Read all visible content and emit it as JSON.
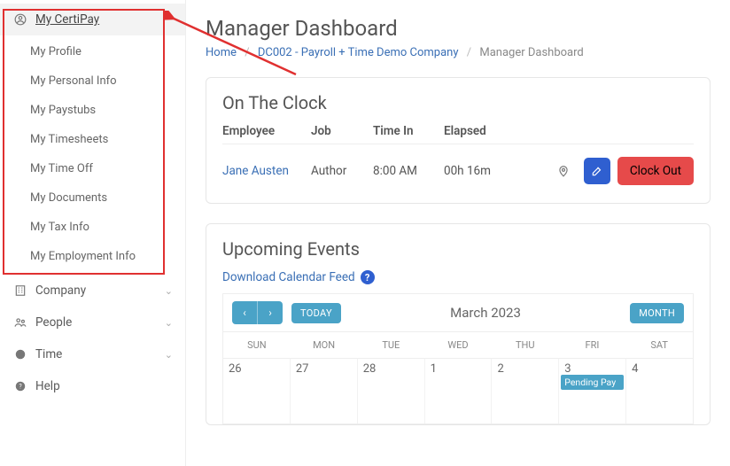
{
  "sidebar": {
    "header": {
      "label": "My CertiPay"
    },
    "items": [
      {
        "label": "My Profile"
      },
      {
        "label": "My Personal Info"
      },
      {
        "label": "My Paystubs"
      },
      {
        "label": "My Timesheets"
      },
      {
        "label": "My Time Off"
      },
      {
        "label": "My Documents"
      },
      {
        "label": "My Tax Info"
      },
      {
        "label": "My Employment Info"
      }
    ],
    "sections": [
      {
        "label": "Company"
      },
      {
        "label": "People"
      },
      {
        "label": "Time"
      },
      {
        "label": "Help"
      }
    ]
  },
  "page": {
    "title": "Manager Dashboard",
    "breadcrumb": {
      "home": "Home",
      "company": "DC002 - Payroll + Time Demo Company",
      "current": "Manager Dashboard"
    }
  },
  "clock": {
    "title": "On The Clock",
    "headers": {
      "employee": "Employee",
      "job": "Job",
      "timein": "Time In",
      "elapsed": "Elapsed"
    },
    "rows": [
      {
        "employee": "Jane Austen",
        "job": "Author",
        "timein": "8:00 AM",
        "elapsed": "00h 16m",
        "clockout": "Clock Out"
      }
    ]
  },
  "events": {
    "title": "Upcoming Events",
    "download": "Download Calendar Feed",
    "today": "TODAY",
    "month_btn": "MONTH",
    "month_label": "March 2023",
    "dow": [
      "SUN",
      "MON",
      "TUE",
      "WED",
      "THU",
      "FRI",
      "SAT"
    ],
    "row1": [
      "26",
      "27",
      "28",
      "1",
      "2",
      "3",
      "4"
    ],
    "event_label": "Pending Pay"
  }
}
